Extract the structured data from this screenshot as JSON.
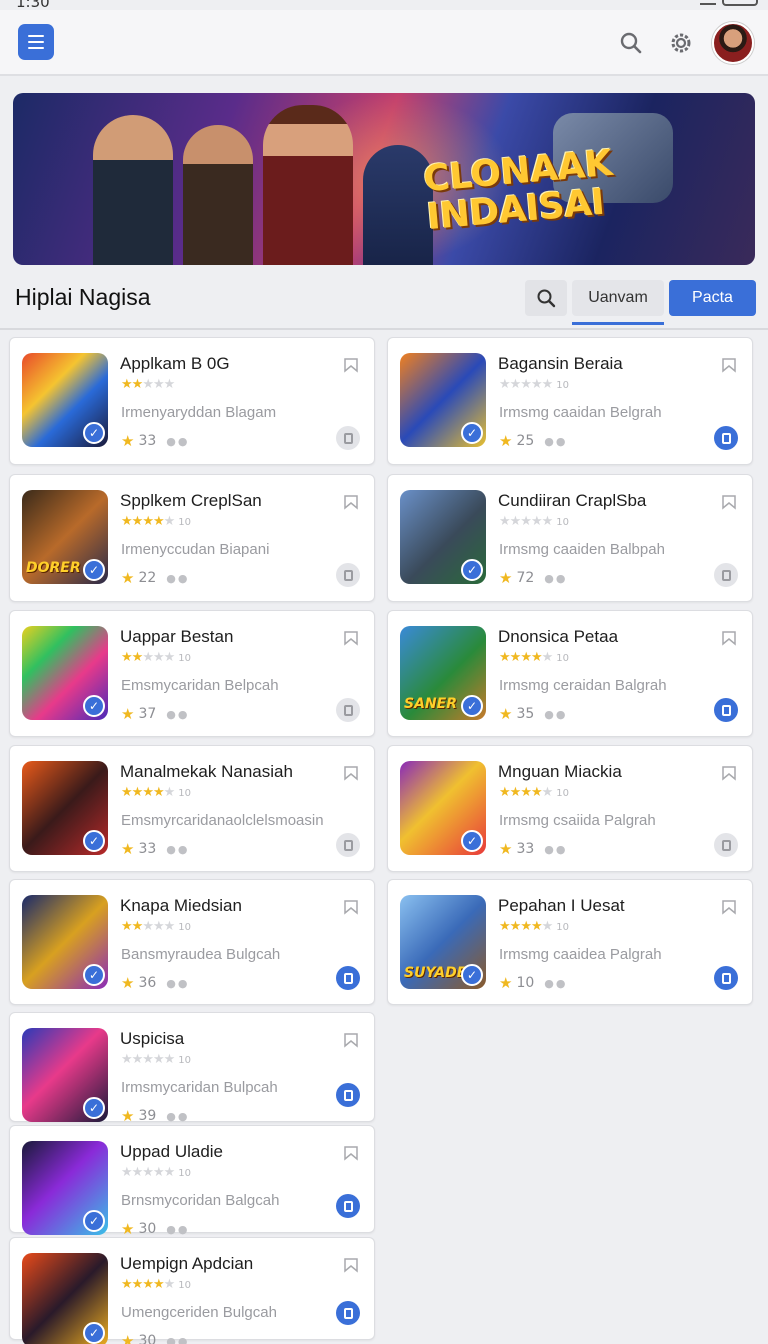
{
  "status": {
    "time": "1:30"
  },
  "header": {
    "menu_icon": "hamburger-menu-icon",
    "search_icon": "search-icon",
    "settings_icon": "gear-icon",
    "avatar": "user-avatar",
    "accent": "#3a6fd8"
  },
  "hero": {
    "title_line1": "CLONAAK",
    "title_line2": "INDAISAI"
  },
  "section": {
    "title": "Hiplai Nagisa",
    "tab_label": "Uanvam",
    "primary_label": "Pacta"
  },
  "cards": [
    {
      "title": "Applkam B 0G",
      "rating": 2,
      "rating_count": "",
      "subtitle": "Irmenyaryddan Blagam",
      "score": "33",
      "thumb_text": "",
      "action": "muted"
    },
    {
      "title": "Bagansin Beraia",
      "rating": 0,
      "rating_count": "10",
      "subtitle": "Irmsmg caaidan Belgrah",
      "score": "25",
      "thumb_text": "",
      "action": "filled"
    },
    {
      "title": "Spplkem CreplSan",
      "rating": 4,
      "rating_count": "10",
      "subtitle": "Irmenyccudan Biapani",
      "score": "22",
      "thumb_text": "DORER",
      "action": "muted"
    },
    {
      "title": "Cundiiran CraplSba",
      "rating": 0,
      "rating_count": "10",
      "subtitle": "Irmsmg caaiden Balbpah",
      "score": "72",
      "thumb_text": "",
      "action": "muted"
    },
    {
      "title": "Uappar Bestan",
      "rating": 2,
      "rating_count": "10",
      "subtitle": "Emsmycaridan Belpcah",
      "score": "37",
      "thumb_text": "",
      "action": "muted"
    },
    {
      "title": "Dnonsica Petaa",
      "rating": 4,
      "rating_count": "10",
      "subtitle": "Irmsmg ceraidan Balgrah",
      "score": "35",
      "thumb_text": "SANER",
      "action": "filled"
    },
    {
      "title": "Manalmekak Nanasiah",
      "rating": 4,
      "rating_count": "10",
      "subtitle": "Emsmyrcaridanaolclelsmoasin",
      "score": "33",
      "thumb_text": "",
      "action": "muted"
    },
    {
      "title": "Mnguan Miackia",
      "rating": 4,
      "rating_count": "10",
      "subtitle": "Irmsmg csaiida Palgrah",
      "score": "33",
      "thumb_text": "",
      "action": "muted"
    },
    {
      "title": "Knapa Miedsian",
      "rating": 2,
      "rating_count": "10",
      "subtitle": "Bansmyraudea Bulgcah",
      "score": "36",
      "thumb_text": "",
      "action": "filled"
    },
    {
      "title": "Pepahan I Uesat",
      "rating": 4,
      "rating_count": "10",
      "subtitle": "Irmsmg caaidea Palgrah",
      "score": "10",
      "thumb_text": "SUYADE",
      "action": "filled"
    },
    {
      "title": "Uspicisa",
      "rating": 0,
      "rating_count": "10",
      "subtitle": "Irmsmycaridan Bulpcah",
      "score": "39",
      "thumb_text": "",
      "action": "filled"
    },
    {
      "title": "Uppad Uladie",
      "rating": 0,
      "rating_count": "10",
      "subtitle": "Brnsmycoridan Balgcah",
      "score": "30",
      "thumb_text": "",
      "action": "filled"
    },
    {
      "title": "Uempign Apdcian",
      "rating": 4,
      "rating_count": "10",
      "subtitle": "Umengceriden Bulgcah",
      "score": "30",
      "thumb_text": "",
      "action": "filled"
    }
  ]
}
